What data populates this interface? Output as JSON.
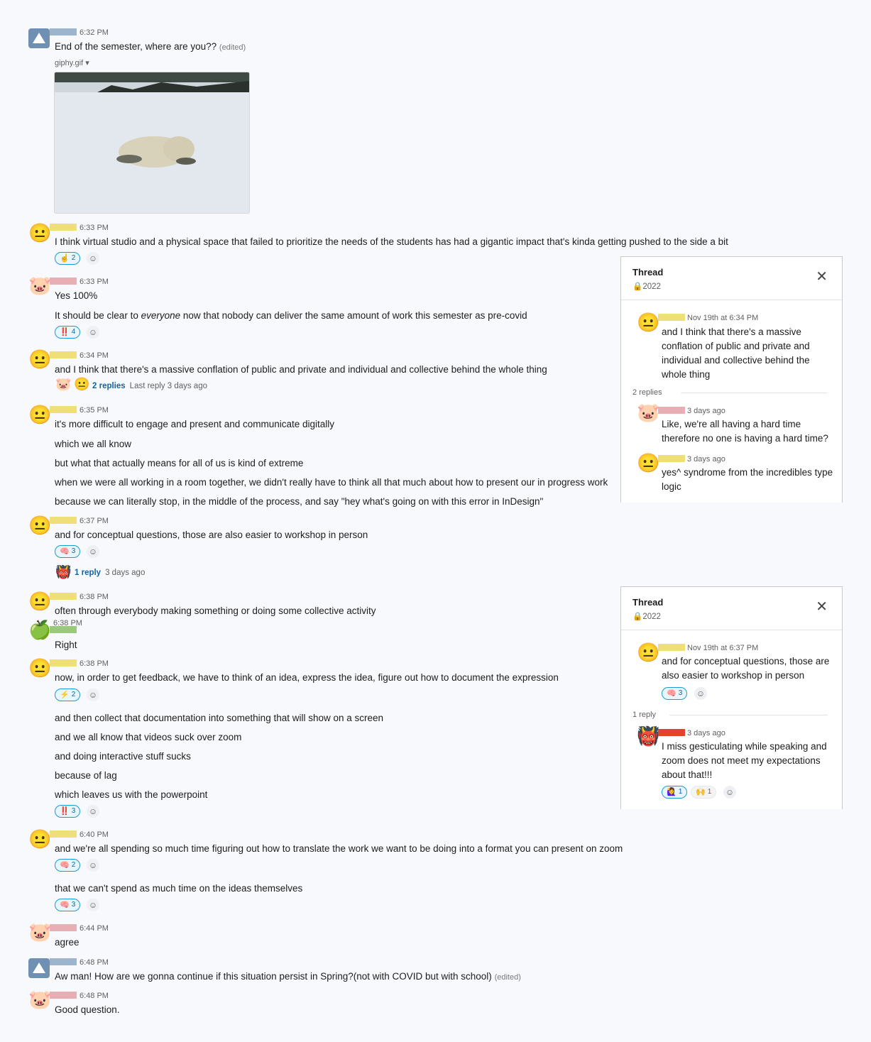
{
  "messages": {
    "m1": {
      "time": "6:32 PM",
      "text": "End of the semester, where are you??",
      "edited": "(edited)",
      "file": "giphy.gif"
    },
    "m2": {
      "time": "6:33 PM",
      "text": "I think virtual studio and a physical space that failed to prioritize the needs of the students has had a gigantic impact that's kinda getting pushed to the side a bit",
      "reaction": {
        "icon": "☝️",
        "count": "2"
      }
    },
    "m3": {
      "time": "6:33 PM",
      "text1": "Yes 100%",
      "text2_pre": "It should be clear to ",
      "text2_em": "everyone",
      "text2_post": " now that nobody can deliver the same amount of work this semester as pre-covid",
      "reaction": {
        "icon": "‼️",
        "count": "4"
      }
    },
    "m4": {
      "time": "6:34 PM",
      "text": "and I think that there's a massive conflation of public and private and individual and collective behind the whole thing",
      "replies": "2 replies",
      "last_reply": "Last reply 3 days ago"
    },
    "m5": {
      "time": "6:35 PM",
      "lines": [
        "it's more difficult to engage and present and communicate digitally",
        "which we all know",
        "but what that actually means for all of us is kind of extreme",
        "when we were all working in a room together, we didn't really have to think all that much about how to present our in progress work",
        "because we can literally stop, in the middle of the process, and say \"hey what's going on with this error in InDesign\""
      ]
    },
    "m6": {
      "time": "6:37 PM",
      "text": "and for conceptual questions, those are also easier to workshop in person",
      "reaction": {
        "icon": "🧠",
        "count": "3"
      },
      "replies": "1 reply",
      "last_reply": "3 days ago"
    },
    "m7": {
      "time": "6:38 PM",
      "text": "often through everybody making something or doing some collective activity"
    },
    "m8": {
      "time": "6:38 PM",
      "text": "Right"
    },
    "m9": {
      "time": "6:38 PM",
      "text": "now, in order to get feedback, we have to think of an idea, express the idea, figure out how to document the expression",
      "reaction": {
        "icon": "⚡",
        "count": "2"
      },
      "lines": [
        "and then collect that documentation into something that will show on a screen",
        "and we all know that videos suck over zoom",
        "and doing interactive stuff sucks",
        "because of lag",
        "which leaves us with the powerpoint"
      ],
      "reaction2": {
        "icon": "‼️",
        "count": "3"
      }
    },
    "m10": {
      "time": "6:40 PM",
      "text": "and we're all spending so much time figuring out how to translate the work we want to be doing into a format you can present on zoom",
      "reaction": {
        "icon": "🧠",
        "count": "2"
      },
      "text2": "that we can't spend as much time on the ideas themselves",
      "reaction2": {
        "icon": "🧠",
        "count": "3"
      }
    },
    "m11": {
      "time": "6:44 PM",
      "text": "agree"
    },
    "m12": {
      "time": "6:48 PM",
      "text": "Aw man! How are we gonna continue if this situation persist in Spring?(not with COVID but with school)",
      "edited": "(edited)"
    },
    "m13": {
      "time": "6:48 PM",
      "text": "Good question."
    }
  },
  "thread1": {
    "title": "Thread",
    "channel": "🔒2022",
    "close": "✕",
    "parent": {
      "time": "Nov 19th at 6:34 PM",
      "text": "and I think that there's a massive conflation of public and private and individual and collective behind the whole thing"
    },
    "count": "2 replies",
    "r1": {
      "time": "3 days ago",
      "text": "Like, we're all having a hard time therefore no one is having a hard time?"
    },
    "r2": {
      "time": "3 days ago",
      "text": "yes^ syndrome from the incredibles type logic"
    }
  },
  "thread2": {
    "title": "Thread",
    "channel": "🔒2022",
    "close": "✕",
    "parent": {
      "time": "Nov 19th at 6:37 PM",
      "text": "and for conceptual questions, those are also easier to workshop in person",
      "reaction": {
        "icon": "🧠",
        "count": "3"
      }
    },
    "count": "1 reply",
    "r1": {
      "time": "3 days ago",
      "text": "I miss gesticulating while speaking and zoom does not meet my expectations about that!!!",
      "reactions": [
        {
          "icon": "🙋‍♀️",
          "count": "1"
        },
        {
          "icon": "🙌",
          "count": "1"
        }
      ]
    }
  },
  "icons": {
    "neutral": "😐",
    "pig": "🐷",
    "apple": "🍏",
    "ghoul": "👹",
    "add_reaction": "☺"
  },
  "colors": {
    "link": "#1264a3",
    "reaction_border": "#1d9bd1",
    "name_yellow": "#eedf78",
    "name_pink": "#e7aeb3",
    "name_blue": "#9db5cc",
    "name_green": "#9bc97c",
    "name_red": "#e3432c"
  }
}
